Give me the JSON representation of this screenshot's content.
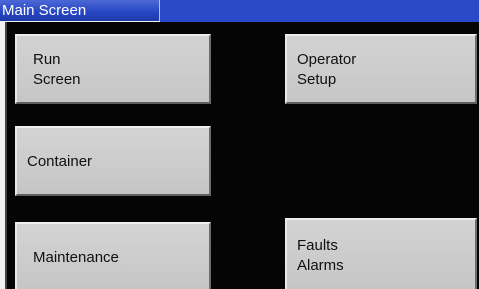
{
  "window": {
    "title": "Main Screen"
  },
  "buttons": {
    "run_screen": "Run\nScreen",
    "operator_setup": "Operator\nSetup",
    "container": "Container",
    "maintenance": "Maintenance",
    "faults_alarms": "Faults\nAlarms"
  },
  "colors": {
    "title_bar": "#2a49c8",
    "panel_background": "#050505",
    "button_face": "#cccccc",
    "text": "#101010"
  }
}
